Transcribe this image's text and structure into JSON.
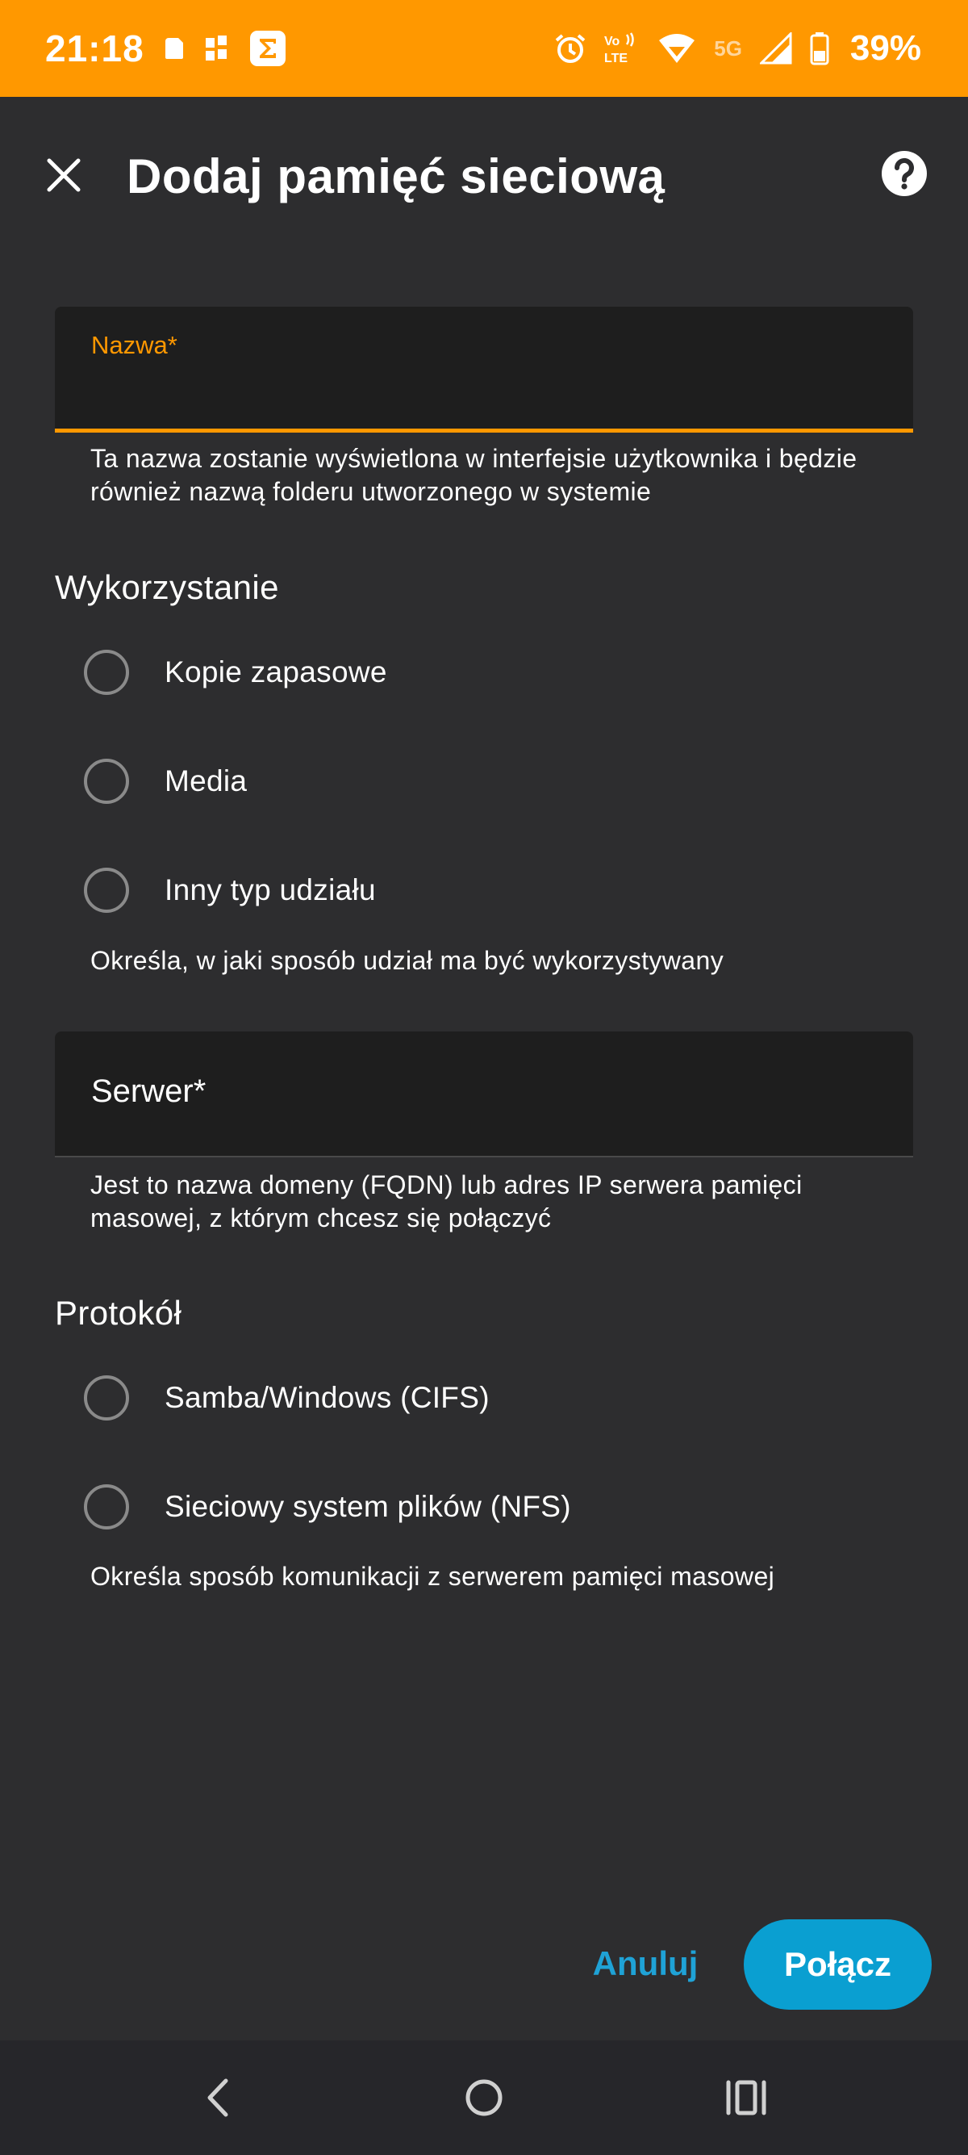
{
  "status_bar": {
    "time": "21:18",
    "network": "5G",
    "battery": "39%"
  },
  "header": {
    "title": "Dodaj pamięć sieciową",
    "close_icon": "close-icon",
    "help_icon": "help-icon"
  },
  "form": {
    "name_field": {
      "label": "Nazwa*",
      "value": "",
      "helper": "Ta nazwa zostanie wyświetlona w interfejsie użytkownika i będzie również nazwą folderu utworzonego w systemie"
    },
    "usage": {
      "title": "Wykorzystanie",
      "options": [
        "Kopie zapasowe",
        "Media",
        "Inny typ udziału"
      ],
      "selected": null,
      "helper": "Określa, w jaki sposób udział ma być wykorzystywany"
    },
    "server_field": {
      "label": "Serwer*",
      "value": "",
      "helper": "Jest to nazwa domeny (FQDN) lub adres IP serwera pamięci masowej, z którym chcesz się połączyć"
    },
    "protocol": {
      "title": "Protokół",
      "options": [
        "Samba/Windows (CIFS)",
        "Sieciowy system plików (NFS)"
      ],
      "selected": null,
      "helper": "Określa sposób komunikacji z serwerem pamięci masowej"
    }
  },
  "actions": {
    "cancel": "Anuluj",
    "connect": "Połącz"
  },
  "colors": {
    "accent": "#ff9800",
    "primary_button": "#0a9fd1",
    "link": "#1fa2d6",
    "background": "#2d2d2f",
    "field_background": "#1e1e1e"
  }
}
